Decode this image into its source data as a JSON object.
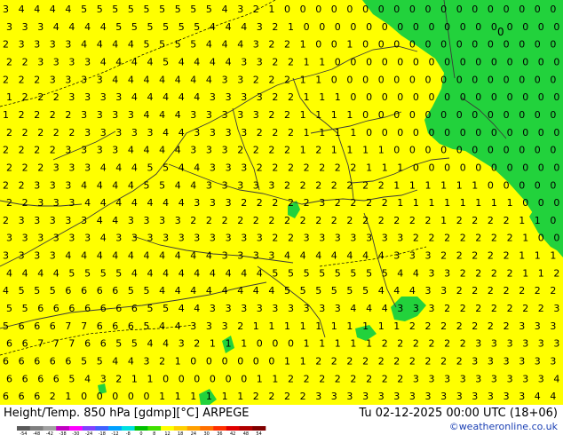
{
  "title": "Height/Temp. 850 hPa [gdmp][°C] ARPEGE",
  "valid_time": "Tu 02-12-2025 00:00 UTC (18+06)",
  "credit": "©weatheronline.co.uk",
  "colorbar": {
    "labels": [
      "-54",
      "-48",
      "-42",
      "-38",
      "-30",
      "-24",
      "-18",
      "-12",
      "-8",
      "0",
      "8",
      "12",
      "18",
      "24",
      "30",
      "36",
      "42",
      "48",
      "54"
    ],
    "colors": [
      "#5a5a5a",
      "#7f7f7f",
      "#a0a0a0",
      "#c000c0",
      "#ff00ff",
      "#8040ff",
      "#4060ff",
      "#00a0ff",
      "#00e0e0",
      "#00c000",
      "#40e000",
      "#ffff00",
      "#ffd000",
      "#ffa000",
      "#ff7000",
      "#ff3000",
      "#e00000",
      "#b00000",
      "#800000"
    ]
  },
  "map": {
    "field_colors": {
      "above_0": "#ffff00",
      "below_0": "#22d23c"
    },
    "contour_color": "#000000",
    "cold_region_label": "0",
    "row_values": [
      "3 4 4 4 4 5 5 5 5 5 5 5 5 5 4 3 2 1 0 0 0 0 0 0 0 0 0 0 0 0 0 0 0 0 0 0",
      "3 3 3 4 4 4 4 5 5 5 5 5 5 4 4 4 3 2 1 0 0 0 0 0 0 0 0 0 0 0 0 0 0 0 0 0",
      "2 3 3 3 3 4 4 4 4 5 5 5 5 4 4 4 3 2 2 1 0 0 1 0 0 0 0 0 0 0 0 0 0 0 0 0",
      "2 2 3 3 3 3 4 4 4 4 5 4 4 4 4 3 3 2 2 1 1 0 0 0 0 0 0 0 0 0 0 0 0 0 0 0",
      "2 2 2 3 3 3 3 4 4 4 4 4 4 4 3 3 2 2 2 1 1 0 0 0 0 0 0 0 0 0 0 0 0 0 0 0",
      "1 2 2 2 3 3 3 3 4 4 4 4 4 3 3 3 3 2 2 1 1 1 0 0 0 0 0 0 0 0 0 0 0 0 0 0",
      "1 2 2 2 2 3 3 3 3 4 4 4 3 3 3 3 3 2 2 1 1 1 1 0 0 0 0 0 0 0 0 0 0 0 0 0",
      "2 2 2 2 2 3 3 3 3 3 4 4 3 3 3 3 2 2 2 1 1 1 1 0 0 0 0 0 0 0 0 0 0 0 0 0",
      "2 2 2 2 3 3 3 3 4 4 4 4 3 3 3 2 2 2 2 1 2 1 1 1 1 0 0 0 0 0 0 0 0 0 0 0",
      "2 2 2 3 3 3 4 4 4 5 5 4 4 3 3 3 2 2 2 2 2 2 2 1 1 1 0 0 0 0 0 0 0 0 0 0",
      "2 2 3 3 3 4 4 4 4 5 5 4 4 3 3 3 3 3 2 2 2 2 2 2 2 1 1 1 1 1 1 0 0 0 0 0",
      "2 2 3 3 3 4 4 4 4 4 4 4 3 3 3 2 2 2 2 2 3 2 2 2 2 1 1 1 1 1 1 1 1 0 0 0",
      "2 3 3 3 3 3 4 4 3 3 3 3 2 2 2 2 2 2 2 2 2 2 2 2 2 2 2 2 1 2 2 2 2 1 1 0",
      "3 3 3 3 3 3 4 3 3 3 3 3 3 3 3 3 3 2 2 3 3 3 3 3 3 3 2 2 2 2 2 2 2 1 0 0",
      "3 3 3 3 4 4 4 4 4 4 4 4 4 4 3 3 3 3 4 4 4 4 4 4 4 3 3 3 2 2 2 2 2 1 1 1",
      "4 4 4 4 5 5 5 5 4 4 4 4 4 4 4 4 4 5 5 5 5 5 5 5 5 4 4 3 3 2 2 2 2 1 1 2",
      "4 5 5 5 6 6 6 6 5 5 4 4 4 4 4 4 4 4 5 5 5 5 5 5 4 4 4 3 3 2 2 2 2 2 2 2",
      "5 5 6 6 6 6 6 6 6 5 5 4 4 3 3 3 3 3 3 3 3 3 4 4 4 3 3 3 2 2 2 2 2 2 2 3",
      "5 6 6 6 7 7 6 6 6 5 4 4 3 3 3 2 1 1 1 1 1 1 1 1 1 1 2 2 2 2 2 2 2 3 3 3",
      "6 6 7 7 7 6 6 5 5 4 4 3 2 1 1 1 0 0 0 1 1 1 1 1 2 2 2 2 2 2 3 3 3 3 3 3",
      "6 6 6 6 6 5 5 4 4 3 2 1 0 0 0 0 0 0 1 1 2 2 2 2 2 2 2 2 2 2 3 3 3 3 3 3",
      "6 6 6 6 5 4 3 2 1 1 0 0 0 0 0 0 1 1 2 2 2 2 2 2 2 2 3 3 3 3 3 3 3 3 3 4",
      "6 6 6 2 1 0 0 0 0 0 1 1 1 1 1 1 2 2 2 2 3 3 3 3 3 3 3 3 3 3 3 3 3 3 4 4"
    ]
  }
}
